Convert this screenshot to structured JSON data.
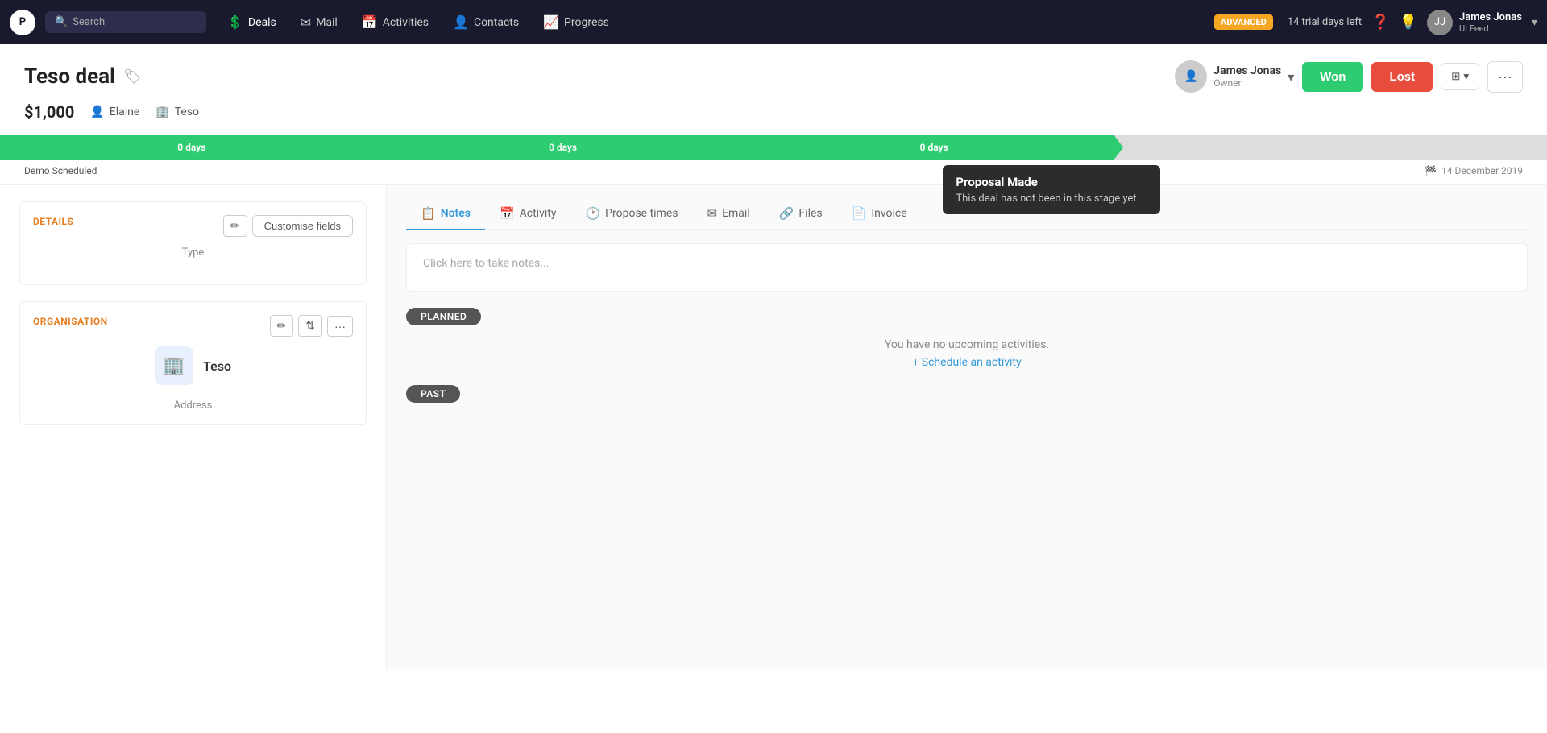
{
  "app": {
    "logo_text": "P"
  },
  "nav": {
    "search_placeholder": "Search",
    "items": [
      {
        "id": "deals",
        "icon": "💲",
        "label": "Deals",
        "active": true
      },
      {
        "id": "mail",
        "icon": "✉",
        "label": "Mail"
      },
      {
        "id": "activities",
        "icon": "📅",
        "label": "Activities"
      },
      {
        "id": "contacts",
        "icon": "👤",
        "label": "Contacts"
      },
      {
        "id": "progress",
        "icon": "📈",
        "label": "Progress"
      }
    ],
    "trial_badge": "ADVANCED",
    "trial_text": "14 trial days left",
    "user": {
      "name": "James Jonas",
      "sub": "UI Feed",
      "avatar": "JJ"
    }
  },
  "deal": {
    "title": "Teso deal",
    "amount": "$1,000",
    "person": "Elaine",
    "org": "Teso",
    "owner_name": "James Jonas",
    "owner_role": "Owner",
    "btn_won": "Won",
    "btn_lost": "Lost",
    "date": "14 December 2019"
  },
  "progress": {
    "segments": [
      {
        "label": "0 days",
        "active": true,
        "width": "31%"
      },
      {
        "label": "0 days",
        "active": true,
        "width": "31%"
      },
      {
        "label": "0 days",
        "active": true,
        "width": "31%"
      },
      {
        "label": "",
        "active": false,
        "width": "17%"
      },
      {
        "label": "",
        "active": false,
        "width": "17%"
      }
    ],
    "stage_labels": [
      {
        "label": "Demo Scheduled",
        "width": "62%"
      }
    ],
    "tooltip": {
      "title": "Proposal Made",
      "subtitle": "This deal has not been in this stage yet"
    }
  },
  "details": {
    "section_title": "DETAILS",
    "customise_btn": "Customise fields",
    "type_label": "Type"
  },
  "organisation": {
    "section_title": "ORGANISATION",
    "org_name": "Teso",
    "address_label": "Address"
  },
  "tabs": [
    {
      "id": "notes",
      "icon": "📋",
      "label": "Notes",
      "active": true
    },
    {
      "id": "activity",
      "icon": "📅",
      "label": "Activity"
    },
    {
      "id": "propose",
      "icon": "🕐",
      "label": "Propose times"
    },
    {
      "id": "email",
      "icon": "✉",
      "label": "Email"
    },
    {
      "id": "files",
      "icon": "🔗",
      "label": "Files"
    },
    {
      "id": "invoice",
      "icon": "📄",
      "label": "Invoice"
    }
  ],
  "notes": {
    "placeholder": "Click here to take notes..."
  },
  "planned": {
    "badge": "PLANNED",
    "no_activities": "You have no upcoming activities.",
    "schedule_link": "+ Schedule an activity"
  },
  "past": {
    "badge": "PAST"
  }
}
